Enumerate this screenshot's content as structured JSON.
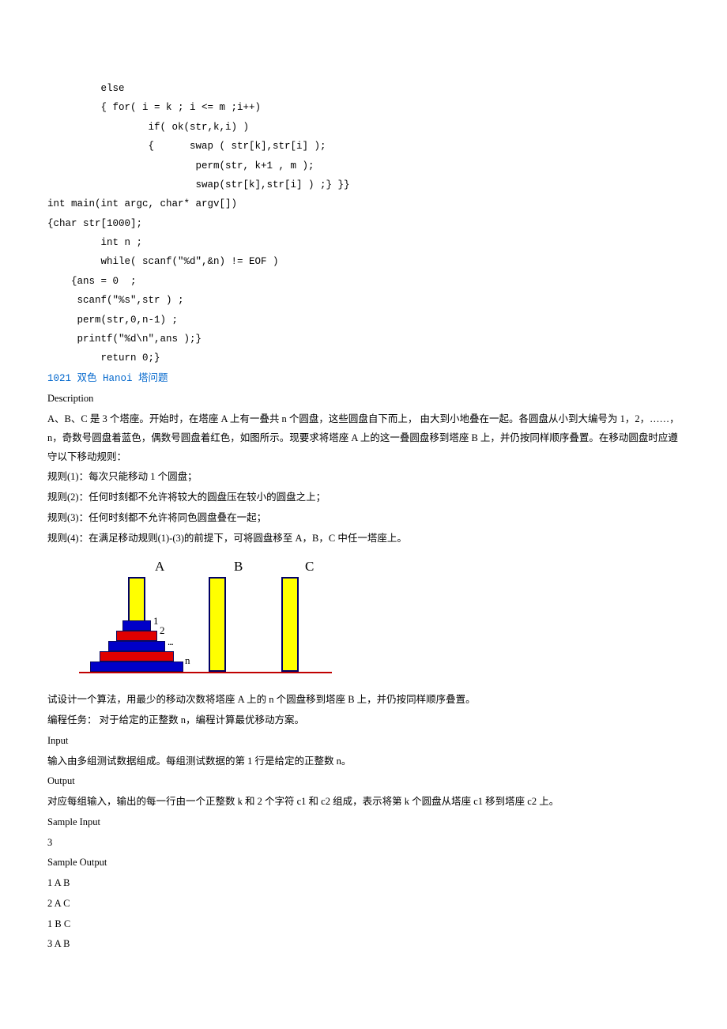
{
  "code_block": "         else\n         { for( i = k ; i <= m ;i++)\n                 if( ok(str,k,i) )\n                 {      swap ( str[k],str[i] );\n                         perm(str, k+1 , m );\n                         swap(str[k],str[i] ) ;} }}\nint main(int argc, char* argv[])\n{char str[1000];\n         int n ;\n         while( scanf(\"%d\",&n) != EOF )\n    {ans = 0  ;\n     scanf(\"%s\",str ) ;\n     perm(str,0,n-1) ;\n     printf(\"%d\\n\",ans );}\n         return 0;}",
  "problem_title": "1021 双色 Hanoi 塔问题",
  "headings": {
    "description": "Description",
    "input": "Input",
    "output": "Output",
    "sample_input": "Sample Input",
    "sample_output": "Sample Output"
  },
  "desc": {
    "p1": "A、B、C 是 3 个塔座。开始时，在塔座 A 上有一叠共 n 个圆盘，这些圆盘自下而上， 由大到小地叠在一起。各圆盘从小到大编号为 1，2，……，n，奇数号圆盘着蓝色，偶数号圆盘着红色，如图所示。现要求将塔座 A 上的这一叠圆盘移到塔座 B 上，并仍按同样顺序叠置。在移动圆盘时应遵守以下移动规则：",
    "r1": "规则(1)：每次只能移动 1 个圆盘；",
    "r2": "规则(2)：任何时刻都不允许将较大的圆盘压在较小的圆盘之上；",
    "r3": "规则(3)：任何时刻都不允许将同色圆盘叠在一起；",
    "r4": "规则(4)：在满足移动规则(1)-(3)的前提下，可将圆盘移至 A，B，C 中任一塔座上。",
    "p2": "试设计一个算法，用最少的移动次数将塔座 A 上的 n 个圆盘移到塔座 B 上，并仍按同样顺序叠置。",
    "p3": "编程任务：  对于给定的正整数 n，编程计算最优移动方案。"
  },
  "figure": {
    "A": "A",
    "B": "B",
    "C": "C",
    "n1": "1",
    "n2": "2",
    "dots": "...",
    "nn": "n"
  },
  "input_text": "输入由多组测试数据组成。每组测试数据的第 1 行是给定的正整数 n。",
  "output_text": "对应每组输入，输出的每一行由一个正整数 k 和 2 个字符 c1 和 c2 组成，表示将第 k  个圆盘从塔座 c1 移到塔座 c2 上。",
  "sample_input_lines": [
    "3"
  ],
  "sample_output_lines": [
    "1 A B",
    "2 A C",
    "1 B C",
    "3 A B"
  ]
}
